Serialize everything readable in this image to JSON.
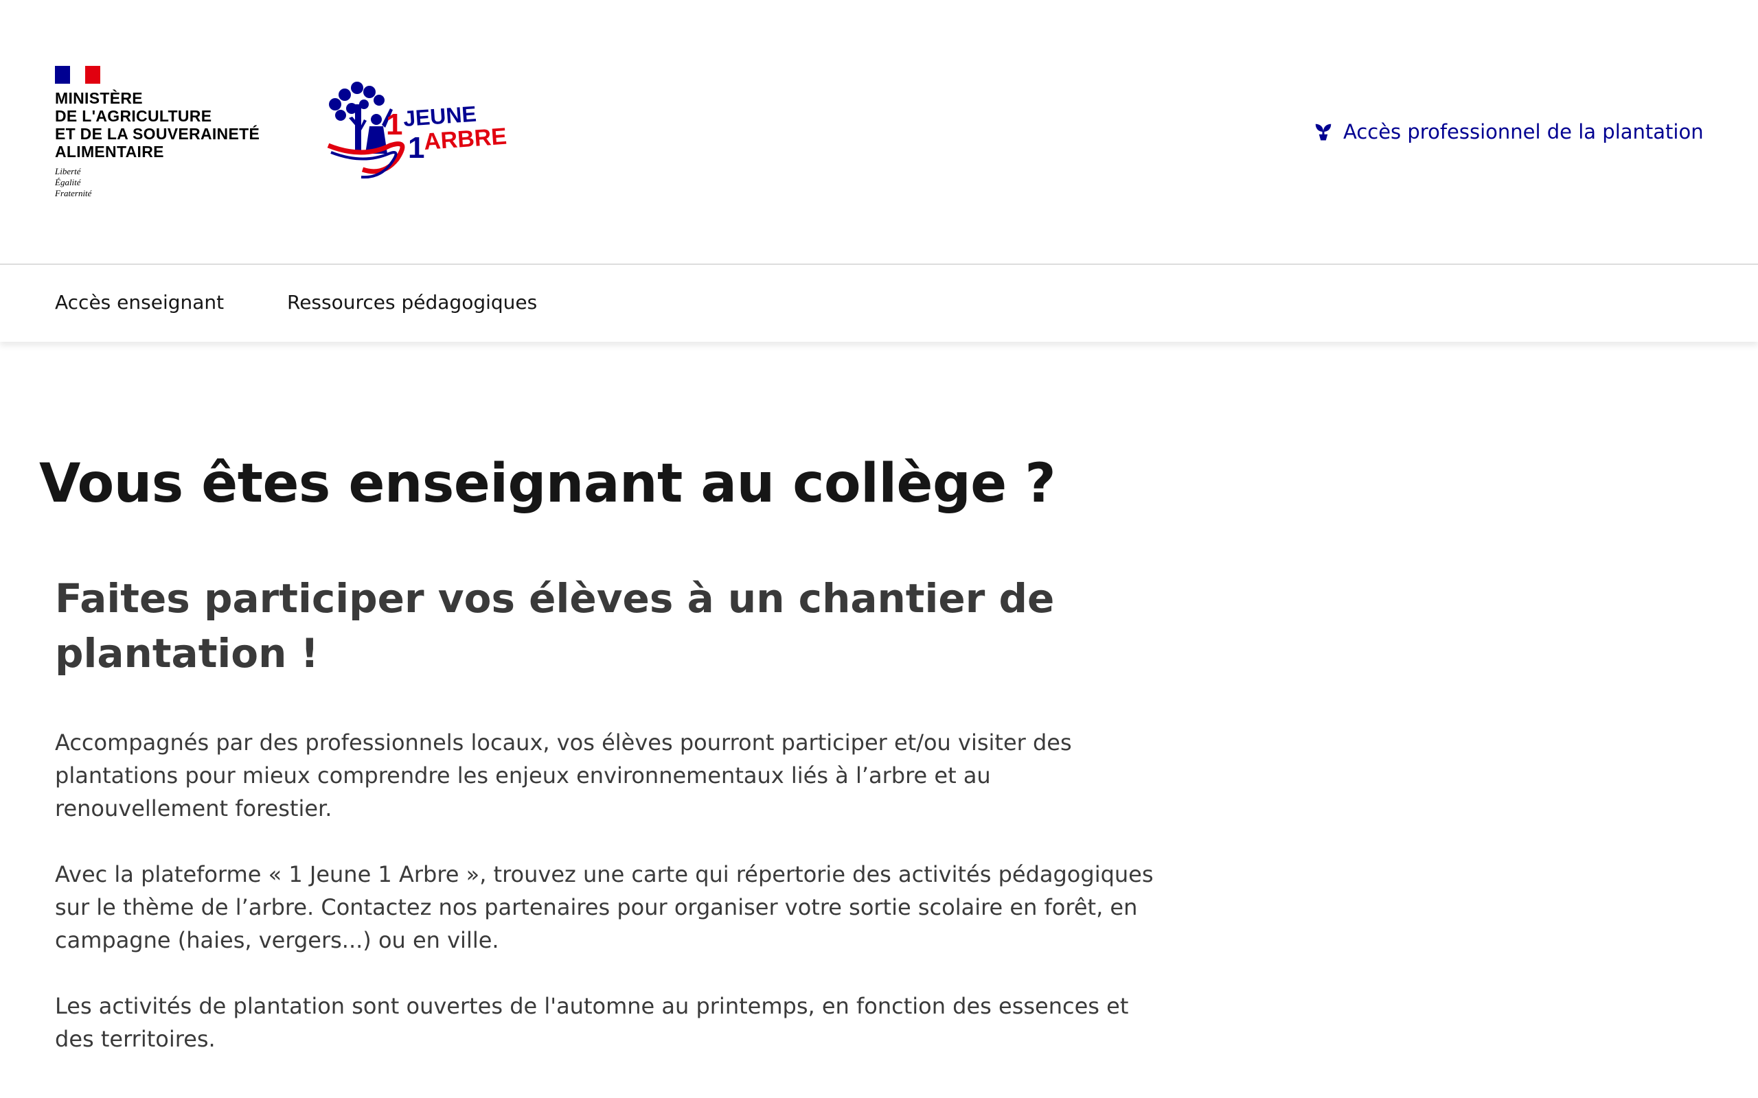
{
  "header": {
    "gov_logo": {
      "lines": [
        "MINISTÈRE",
        "DE L'AGRICULTURE",
        "ET DE LA SOUVERAINETÉ",
        "ALIMENTAIRE"
      ],
      "motto": [
        "Liberté",
        "Égalité",
        "Fraternité"
      ],
      "flag_colors": [
        "#000091",
        "#ffffff",
        "#e1000f"
      ]
    },
    "partner_logo": {
      "line1": "JEUNE",
      "line2": "ARBRE",
      "number": "1",
      "colors": {
        "blue": "#000091",
        "red": "#e1000f"
      }
    },
    "pro_access_label": "Accès professionnel de la plantation",
    "pro_access_icon": "sprout-icon"
  },
  "nav": {
    "items": [
      {
        "label": "Accès enseignant"
      },
      {
        "label": "Ressources pédagogiques"
      }
    ]
  },
  "main": {
    "title": "Vous êtes enseignant au collège ?",
    "subtitle": "Faites participer vos élèves à un chantier de plantation !",
    "paragraphs": [
      "Accompagnés par des professionnels locaux, vos élèves pourront participer et/ou visiter des plantations pour mieux comprendre les enjeux environnementaux liés à l’arbre et au renouvellement forestier.",
      "Avec la plateforme « 1 Jeune 1 Arbre », trouvez une carte qui répertorie des activités pédagogiques sur le thème de l’arbre. Contactez nos partenaires pour organiser votre sortie scolaire en forêt, en campagne (haies, vergers...) ou en ville.",
      "Les activités de plantation sont ouvertes de l'automne au printemps, en fonction des essences et des territoires."
    ]
  },
  "colors": {
    "accent": "#000091",
    "text": "#161616",
    "body_text": "#3a3a3a"
  }
}
